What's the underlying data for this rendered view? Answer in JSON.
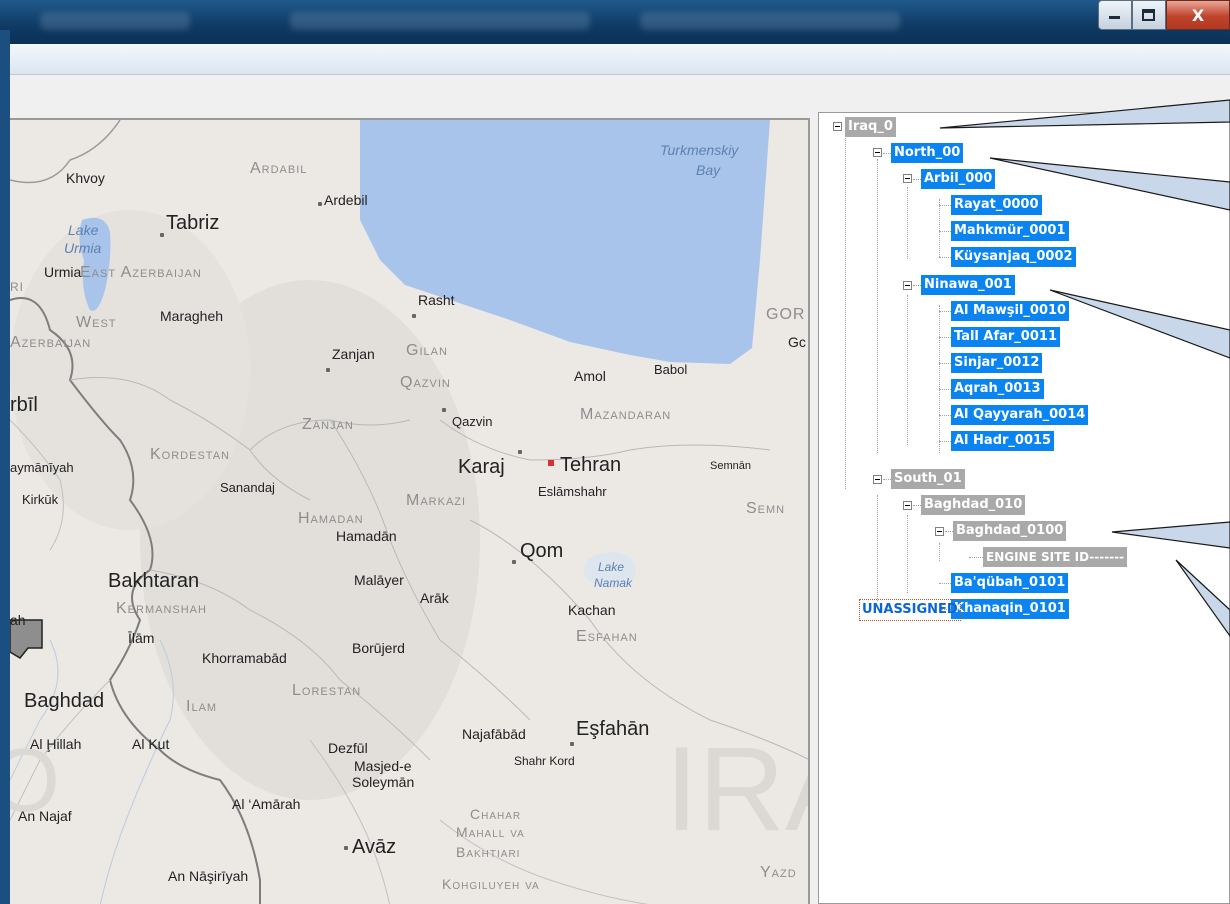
{
  "window": {
    "buttons": {
      "minimize": "minimize-icon",
      "maximize": "maximize-icon",
      "close": "X"
    }
  },
  "map": {
    "water_labels": [
      "Turkmenskiy Bay",
      "Lake Urmia",
      "Lake Namak"
    ],
    "turkmenskiy": "Turkmenskiy",
    "bay": "Bay",
    "lake_urmia_1": "Lake",
    "lake_urmia_2": "Urmia",
    "lake_namak_1": "Lake",
    "lake_namak_2": "Namak",
    "cities": {
      "khvoy": "Khvoy",
      "ardebil": "Ardebil",
      "tabriz": "Tabriz",
      "urmia": "Urmia",
      "maragheh": "Maragheh",
      "rasht": "Rasht",
      "zanjan": "Zanjan",
      "amol": "Amol",
      "babol": "Babol",
      "qazvin": "Qazvin",
      "karaj": "Karaj",
      "tehran": "Tehran",
      "semnan": "Semnān",
      "eslamshahr": "Eslāmshahr",
      "sanandaj": "Sanandaj",
      "kirkuk": "Kirkūk",
      "sulaymaniyah": "aymānīyah",
      "erbil": "rbīl",
      "hamadan": "Hamadān",
      "qom": "Qom",
      "malayer": "Malāyer",
      "arak": "Arāk",
      "kachan": "Kachan",
      "bakhtaran": "Bakhtaran",
      "ilam": "Īlām",
      "khorramabad": "Khorramabād",
      "borujerd": "Borūjerd",
      "baghdad": "Baghdad",
      "al_hillah": "Al Ḩillah",
      "al_kut": "Al Kut",
      "dezful": "Dezfūl",
      "masjed1": "Masjed-e",
      "masjed2": "Soleymān",
      "najafabad": "Najafābād",
      "esfahan": "Eşfahān",
      "shahr_kord": "Shahr Kord",
      "al_amarah": "Al ‘Amārah",
      "an_najaf": "An Najaf",
      "avaz": "Avāz",
      "an_nasiriyah": "An Nāşirīyah",
      "gor": "GOR",
      "gc": "Gc",
      "ah": "ah",
      "ri": "RI"
    },
    "provinces": {
      "ardabil": "Ardabil",
      "east_az": "East Azerbaijan",
      "west": "West",
      "azerbaijan": "Azerbaijan",
      "gilan": "Gilan",
      "qazvin": "Qazvin",
      "zanjan": "Zanjan",
      "mazandaran": "Mazandaran",
      "kordestan": "Kordestan",
      "markazi": "Markazi",
      "hamadan": "Hamadan",
      "semn": "Semn",
      "kermanshah": "Kermanshah",
      "lorestan": "Lorestan",
      "ilam": "Ilam",
      "esfahan": "Esfahan",
      "chahar": "Chahar",
      "mahall": "Mahall va",
      "bakhtiari": "Bakhtiari",
      "kohgiluyeh": "Kohgiluyeh va",
      "yazd": "Yazd",
      "ira": "IRA",
      "o": "O"
    }
  },
  "tree": {
    "nodes": [
      {
        "label": "Iraq_0",
        "state": "gray"
      },
      {
        "label": "North_00",
        "state": "selected"
      },
      {
        "label": "Arbil_000",
        "state": "selected"
      },
      {
        "label": "Rayat_0000",
        "state": "selected"
      },
      {
        "label": "Mahkmür_0001",
        "state": "selected"
      },
      {
        "label": "Küysanjaq_0002",
        "state": "selected"
      },
      {
        "label": "Ninawa_001",
        "state": "selected"
      },
      {
        "label": "Al Mawşil_0010",
        "state": "selected"
      },
      {
        "label": "Tall Afar_0011",
        "state": "selected"
      },
      {
        "label": "Sinjar_0012",
        "state": "selected"
      },
      {
        "label": "Aqrah_0013",
        "state": "selected"
      },
      {
        "label": "Al Qayyarah_0014",
        "state": "selected"
      },
      {
        "label": "Al Hadr_0015",
        "state": "selected"
      },
      {
        "label": "South_01",
        "state": "gray"
      },
      {
        "label": "Baghdad_010",
        "state": "gray"
      },
      {
        "label": "Baghdad_0100",
        "state": "gray"
      },
      {
        "label": "ENGINE SITE ID-------",
        "state": "gray"
      },
      {
        "label": "Ba'qübah_0101",
        "state": "selected"
      },
      {
        "label": "Khanaqin_0101",
        "state": "selected"
      },
      {
        "label": "UNASSIGNED",
        "state": "unassigned"
      }
    ]
  },
  "colors": {
    "selected": "#0a84f0",
    "gray": "#a9a9a9",
    "callout": "#c9d7ea",
    "water": "#a9c4ea"
  }
}
